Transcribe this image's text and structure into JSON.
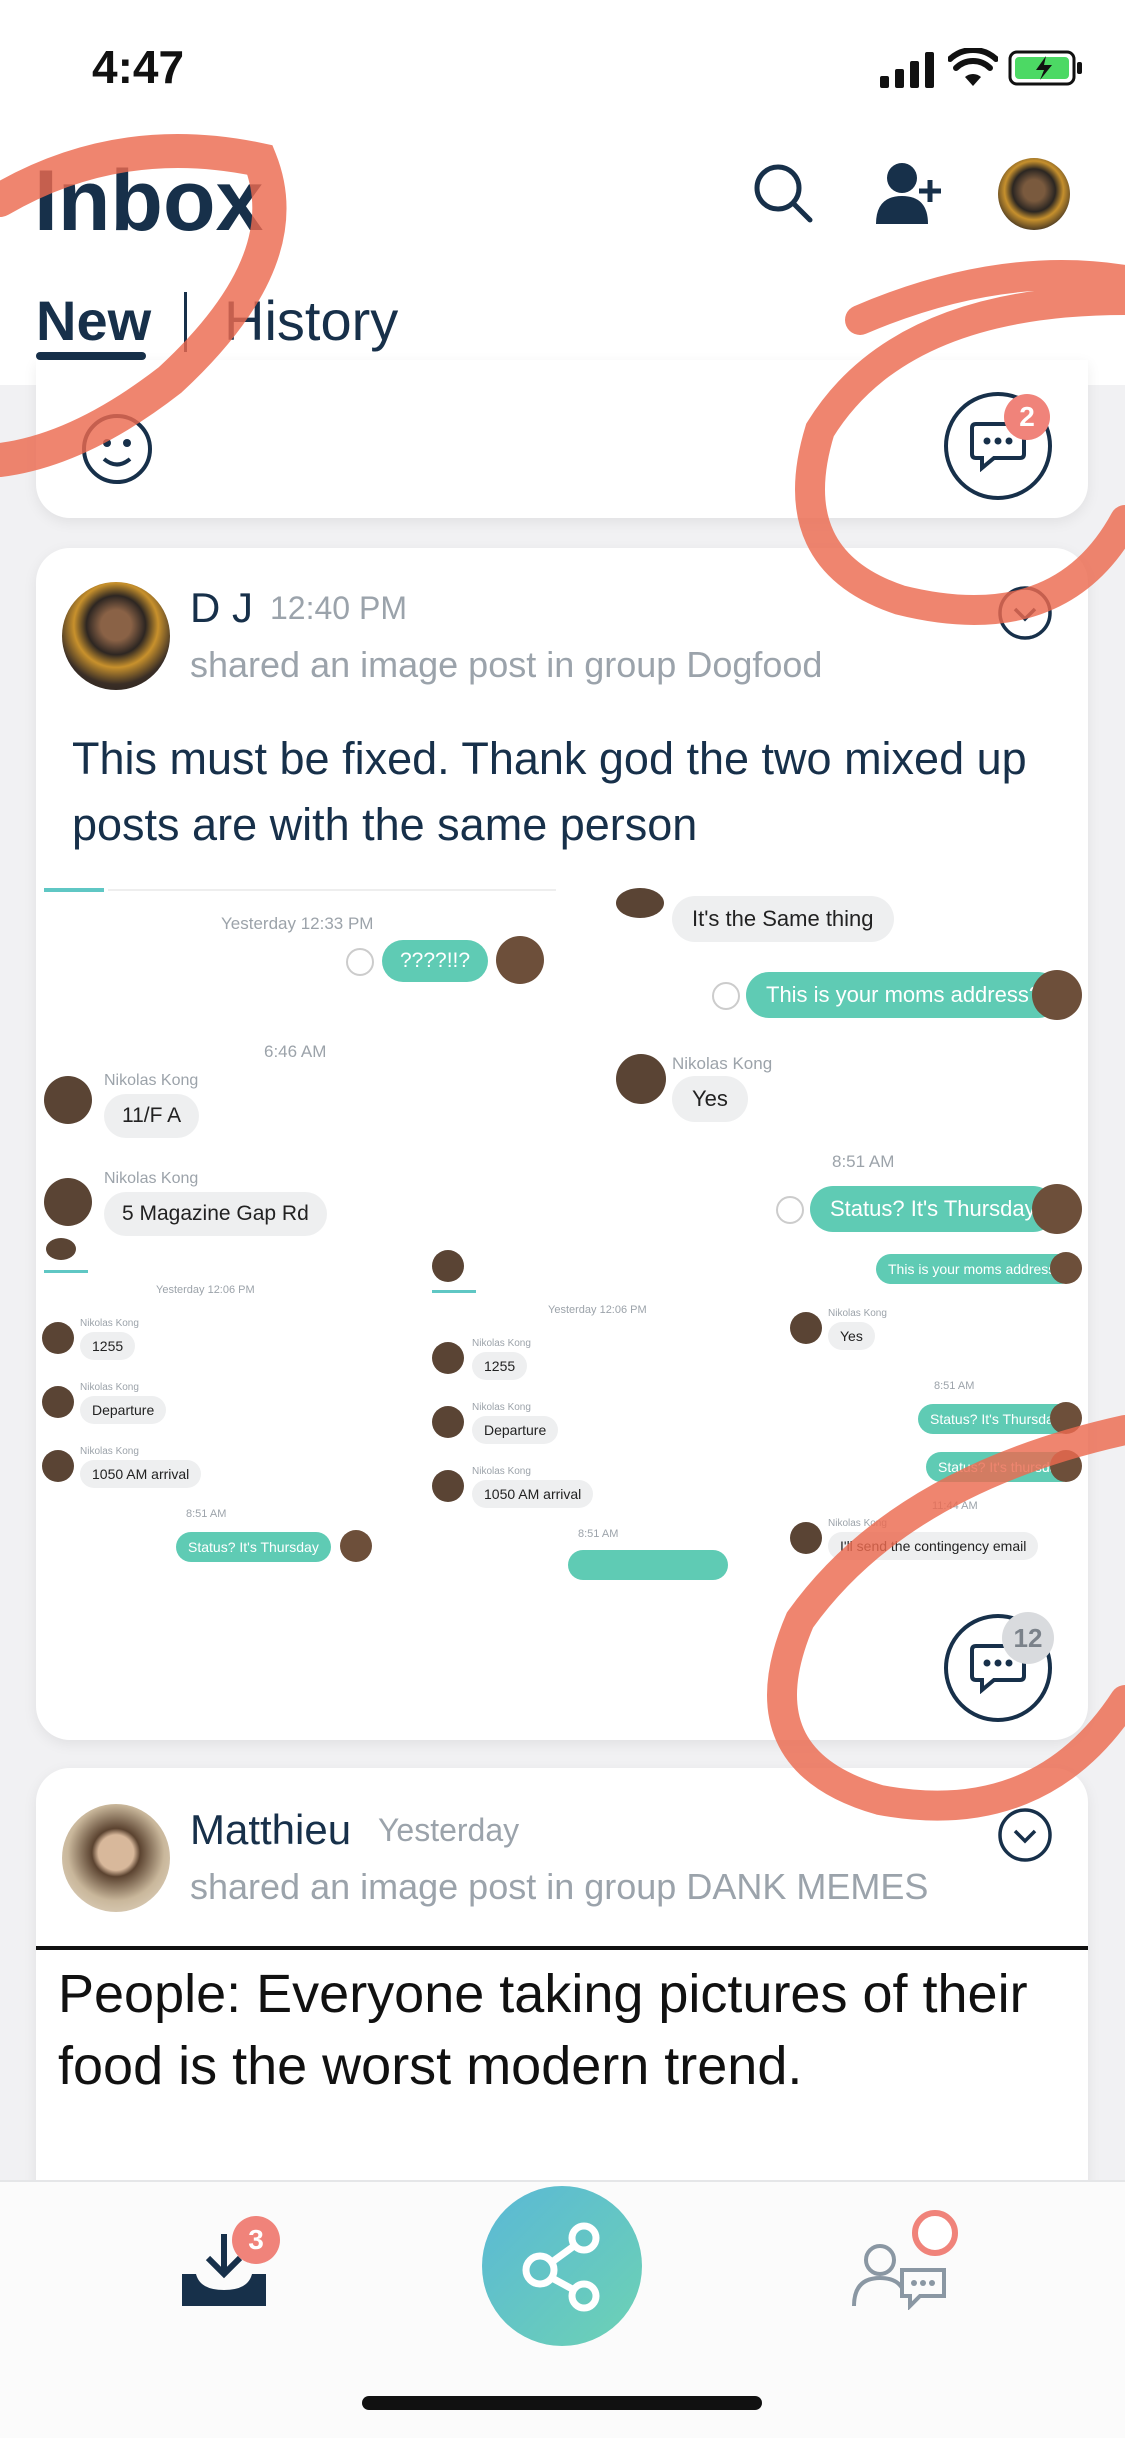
{
  "status_bar": {
    "time": "4:47"
  },
  "header": {
    "title": "Inbox",
    "tabs": [
      "New",
      "History"
    ]
  },
  "top_card": {
    "comment_count": "2"
  },
  "post1": {
    "author": "D J",
    "time": "12:40 PM",
    "subtitle": "shared an image post in group Dogfood",
    "body": "This must be fixed.  Thank god the two mixed up posts are with the same person",
    "comment_count": "12",
    "screenshot_a": {
      "timestamp1": "Yesterday 12:33 PM",
      "msg1": "????!!?",
      "timestamp2": "6:46 AM",
      "sender": "Nikolas Kong",
      "msg2": "11/F A",
      "sender2": "Nikolas Kong",
      "msg3": "5 Magazine Gap Rd"
    },
    "screenshot_b": {
      "sender_top": "Nikolas Kong",
      "msg1": "It's the Same thing",
      "msg2": "This is your moms address?",
      "sender": "Nikolas Kong",
      "msg3": "Yes",
      "timestamp": "8:51 AM",
      "msg4": "Status?  It's Thursday"
    },
    "mini1": {
      "timestamp": "Yesterday 12:06 PM",
      "rows": [
        {
          "sender": "Nikolas Kong",
          "text": "1255"
        },
        {
          "sender": "Nikolas Kong",
          "text": "Departure"
        },
        {
          "sender": "Nikolas Kong",
          "text": "1050 AM arrival"
        }
      ],
      "time2": "8:51 AM",
      "reply": "Status? It's Thursday"
    },
    "mini2": {
      "timestamp": "Yesterday 12:06 PM",
      "rows": [
        {
          "sender": "Nikolas Kong",
          "text": "1255"
        },
        {
          "sender": "Nikolas Kong",
          "text": "Departure"
        },
        {
          "sender": "Nikolas Kong",
          "text": "1050 AM arrival"
        }
      ],
      "time2": "8:51 AM"
    },
    "mini3": {
      "msg1": "This is your moms address?",
      "sender": "Nikolas Kong",
      "msg2": "Yes",
      "time": "8:51 AM",
      "msg3": "Status? It's Thursday",
      "msg4": "Status? It's thursday",
      "time2": "11:44 AM",
      "sender2": "Nikolas Kong",
      "msg5": "I'll send the contingency email"
    }
  },
  "post2": {
    "author": "Matthieu",
    "time": "Yesterday",
    "subtitle": "shared an image post in group DANK MEMES",
    "meme_text": "People: Everyone taking pictures of their food is the worst modern trend."
  },
  "bottom_nav": {
    "inbox_badge": "3"
  },
  "colors": {
    "accent": "#5fc7c4",
    "badge": "#f0837a",
    "ink": "#17304a",
    "annotation": "#ec6a4f"
  }
}
